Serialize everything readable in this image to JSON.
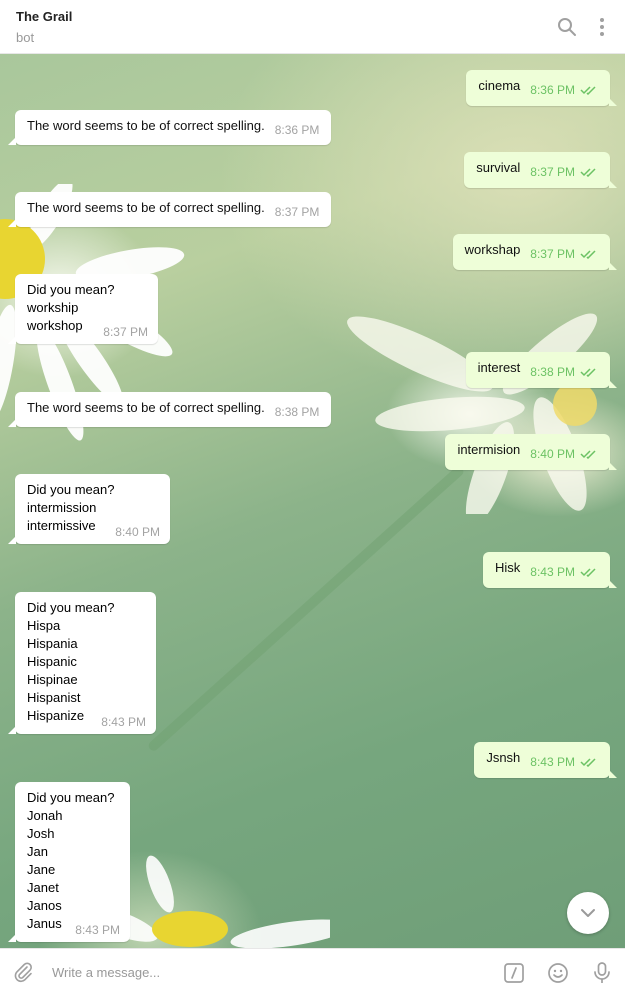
{
  "header": {
    "title": "The Grail",
    "subtitle": "bot"
  },
  "icons": {
    "search": "search-icon",
    "more": "more-vertical-icon",
    "attach": "paperclip-icon",
    "commands": "slash-command-icon",
    "emoji": "smile-icon",
    "mic": "microphone-icon",
    "scroll_down": "chevron-down-icon",
    "read": "double-check-icon"
  },
  "colors": {
    "incoming_bubble": "#ffffff",
    "outgoing_bubble": "#eefed8",
    "outgoing_time": "#6cc264",
    "incoming_time": "#a3a3a3"
  },
  "messages": [
    {
      "dir": "out",
      "text": "cinema",
      "time": "8:36 PM"
    },
    {
      "dir": "in",
      "text": "The word seems to be of correct spelling.",
      "time": "8:36 PM"
    },
    {
      "dir": "out",
      "text": "survival",
      "time": "8:37 PM"
    },
    {
      "dir": "in",
      "text": "The word seems to be of correct spelling.",
      "time": "8:37 PM"
    },
    {
      "dir": "out",
      "text": "workshap",
      "time": "8:37 PM"
    },
    {
      "dir": "in",
      "text": "Did you mean?\nworkship\nworkshop",
      "time": "8:37 PM"
    },
    {
      "dir": "out",
      "text": "interest",
      "time": "8:38 PM"
    },
    {
      "dir": "in",
      "text": "The word seems to be of correct spelling.",
      "time": "8:38 PM"
    },
    {
      "dir": "out",
      "text": "intermision",
      "time": "8:40 PM"
    },
    {
      "dir": "in",
      "text": "Did you mean?\nintermission\nintermissive",
      "time": "8:40 PM"
    },
    {
      "dir": "out",
      "text": "Hisk",
      "time": "8:43 PM"
    },
    {
      "dir": "in",
      "text": "Did you mean?\nHispa\nHispania\nHispanic\nHispinae\nHispanist\nHispanize",
      "time": "8:43 PM"
    },
    {
      "dir": "out",
      "text": "Jsnsh",
      "time": "8:43 PM"
    },
    {
      "dir": "in",
      "text": "Did you mean?\nJonah\nJosh\nJan\nJane\nJanet\nJanos\nJanus",
      "time": "8:43 PM"
    }
  ],
  "composer": {
    "placeholder": "Write a message..."
  }
}
